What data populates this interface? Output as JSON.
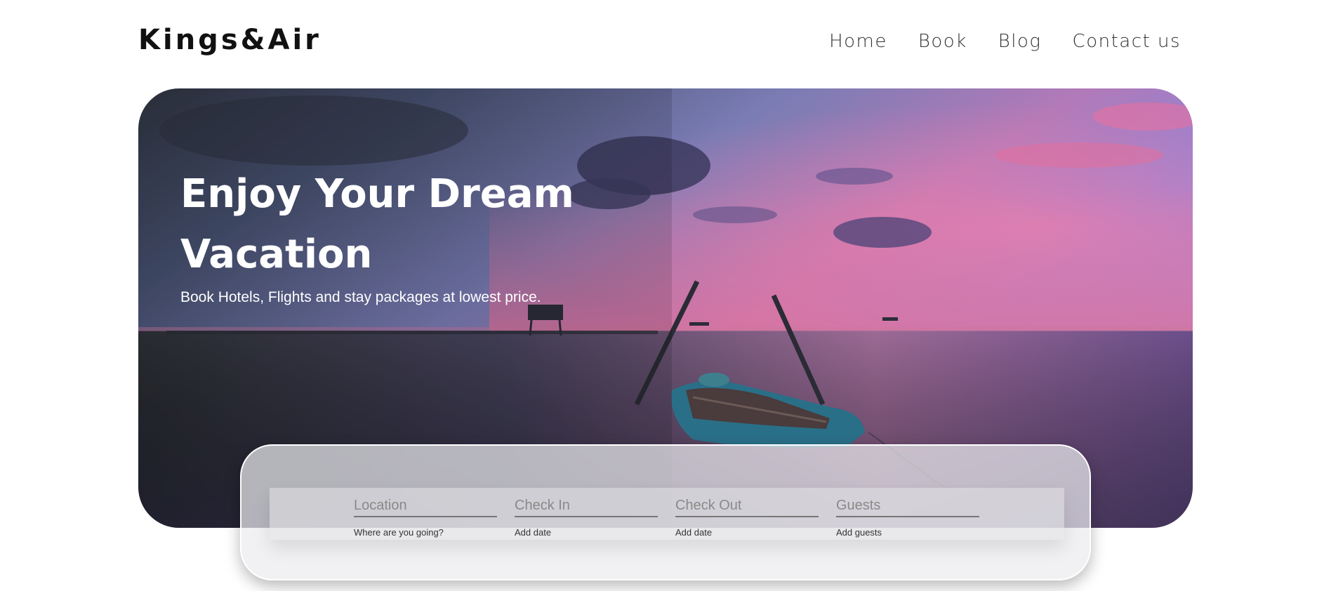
{
  "brand": {
    "logo": "Kings&Air"
  },
  "nav": {
    "items": [
      {
        "label": "Home"
      },
      {
        "label": "Book"
      },
      {
        "label": "Blog"
      },
      {
        "label": "Contact us"
      }
    ]
  },
  "hero": {
    "title": "Enjoy Your Dream Vacation",
    "subtitle": "Book Hotels, Flights and stay packages at lowest price."
  },
  "search": {
    "fields": [
      {
        "placeholder": "Location",
        "hint": "Where are you going?"
      },
      {
        "placeholder": "Check In",
        "hint": "Add date"
      },
      {
        "placeholder": "Check Out",
        "hint": "Add date"
      },
      {
        "placeholder": "Guests",
        "hint": "Add guests"
      }
    ]
  },
  "colors": {
    "sky_top": "#5a6ea6",
    "sky_pink": "#e06fa0",
    "water_dark": "#2f3340",
    "boat_blue": "#2a6f88"
  }
}
